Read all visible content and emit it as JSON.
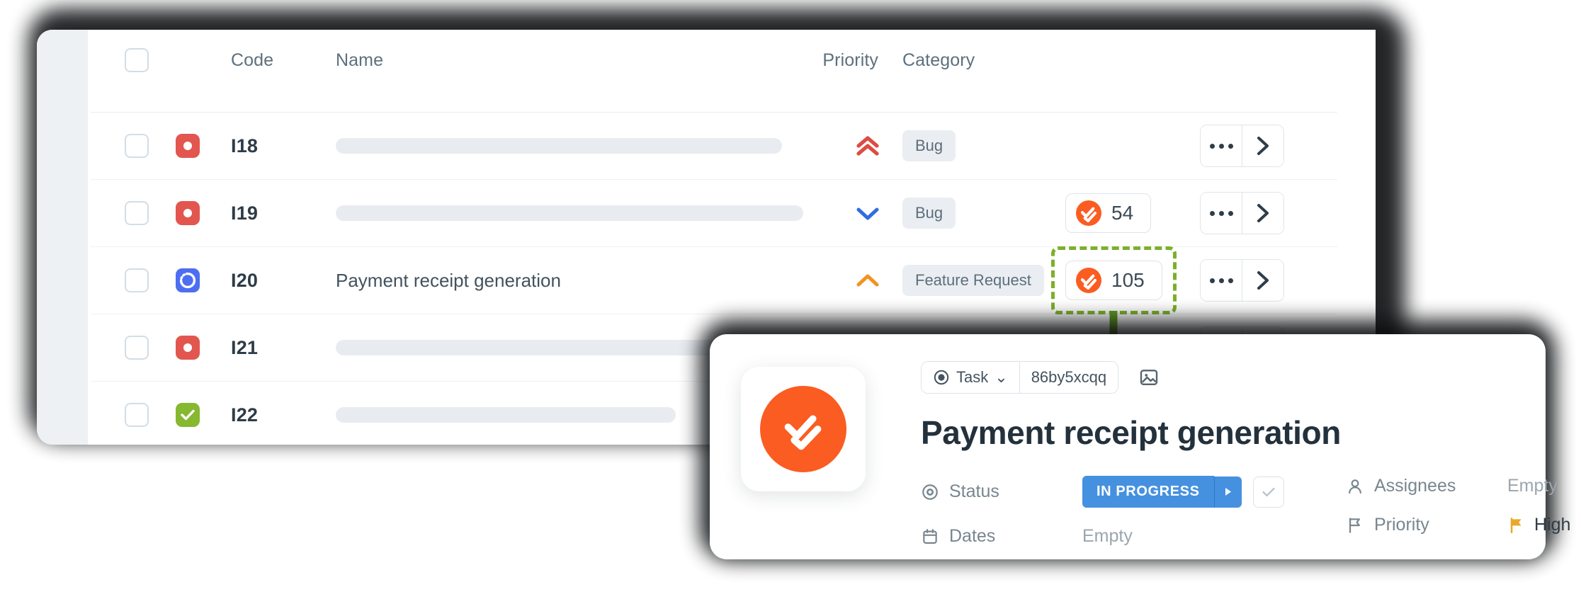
{
  "table": {
    "columns": [
      "",
      "",
      "Code",
      "Name",
      "Priority",
      "Category",
      "",
      ""
    ],
    "headers": {
      "code": "Code",
      "name": "Name",
      "priority": "Priority",
      "category": "Category"
    },
    "rows": [
      {
        "code": "I18",
        "name": "",
        "name_placeholder_width": 630,
        "status_icon": "status-open-red-icon",
        "priority_icon": "priority-urgent-double-chevron-up-icon",
        "priority_color": "#dc4c43",
        "category": "Bug",
        "count": null
      },
      {
        "code": "I19",
        "name": "",
        "name_placeholder_width": 660,
        "status_icon": "status-open-red-icon",
        "priority_icon": "priority-low-chevron-down-icon",
        "priority_color": "#2f6ee0",
        "category": "Bug",
        "count": "54"
      },
      {
        "code": "I20",
        "name": "Payment receipt generation",
        "name_placeholder_width": 0,
        "status_icon": "status-in-progress-blue-icon",
        "priority_icon": "priority-high-chevron-up-icon",
        "priority_color": "#f0941f",
        "category": "Feature Request",
        "count": "105",
        "highlighted": true
      },
      {
        "code": "I21",
        "name": "",
        "name_placeholder_width": 670,
        "status_icon": "status-open-red-icon",
        "priority_icon": "",
        "priority_color": "",
        "category": "",
        "count": null
      },
      {
        "code": "I22",
        "name": "",
        "name_placeholder_width": 480,
        "status_icon": "status-done-green-icon",
        "priority_icon": "",
        "priority_color": "",
        "category": "",
        "count": null
      }
    ],
    "row_actions": {
      "more_label": "···",
      "open_label": "›"
    }
  },
  "highlight": {
    "color": "#7cb02a",
    "target_row_code": "I20",
    "target_value": "105"
  },
  "detail": {
    "type_chip": "Task",
    "type_caret": "⌄",
    "task_id": "86by5xcqq",
    "cover_icon": "image-icon",
    "title": "Payment receipt generation",
    "fields": [
      {
        "label": "Status",
        "icon": "target-icon",
        "value": "IN PROGRESS",
        "kind": "status"
      },
      {
        "label": "Dates",
        "icon": "calendar-icon",
        "value": "Empty",
        "kind": "empty"
      },
      {
        "label": "Assignees",
        "icon": "person-icon",
        "value": "Empty",
        "kind": "empty"
      },
      {
        "label": "Priority",
        "icon": "flag-outline-icon",
        "value": "High",
        "kind": "priority"
      }
    ],
    "status_color": "#4591e0",
    "priority_flag_color": "#e8a92b"
  },
  "colors": {
    "accent_orange": "#fb5c22",
    "status_blue": "#4591e0",
    "highlight_green": "#7cb02a",
    "red": "#e2564f",
    "green": "#86b830"
  }
}
